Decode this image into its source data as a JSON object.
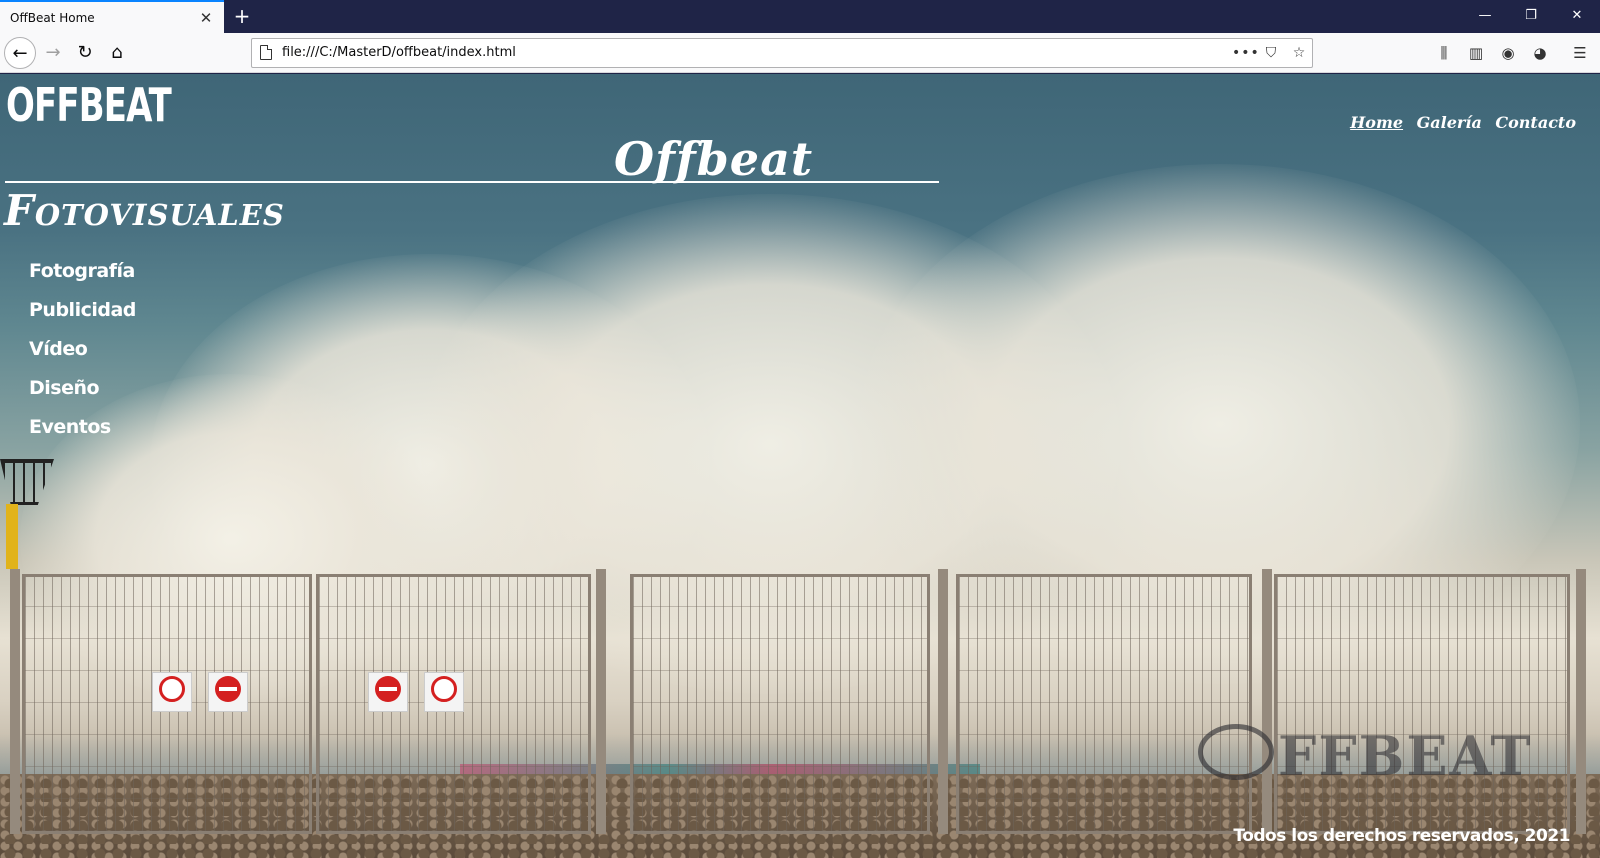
{
  "browser": {
    "tab_title": "OffBeat Home",
    "tab_close": "✕",
    "new_tab": "+",
    "url": "file:///C:/MasterD/offbeat/index.html",
    "window_controls": {
      "minimize": "—",
      "maximize": "❐",
      "close": "✕"
    },
    "nav": {
      "back": "←",
      "forward": "→",
      "reload": "↻",
      "home": "⌂"
    },
    "url_actions": {
      "more": "•••",
      "pocket": "⛉",
      "star": "☆"
    },
    "toolbar": {
      "library": "⫼",
      "sidebar": "▥",
      "account": "◉",
      "extension": "◕",
      "menu": "☰"
    }
  },
  "site": {
    "logo": "OFFBEAT",
    "nav": [
      {
        "label": "Home",
        "active": true
      },
      {
        "label": "Galería",
        "active": false
      },
      {
        "label": "Contacto",
        "active": false
      }
    ],
    "hero_title": "Offbeat",
    "hero_subtitle": "Fotovisuales",
    "menu": [
      "Fotografía",
      "Publicidad",
      "Vídeo",
      "Diseño",
      "Eventos"
    ],
    "watermark": "FFBEAT",
    "footer": "Todos los derechos reservados, 2021"
  },
  "colors": {
    "chrome_dark": "#1f2447",
    "chrome_light": "#f9f9fa",
    "accent": "#0a84ff",
    "text_white": "#ffffff"
  }
}
